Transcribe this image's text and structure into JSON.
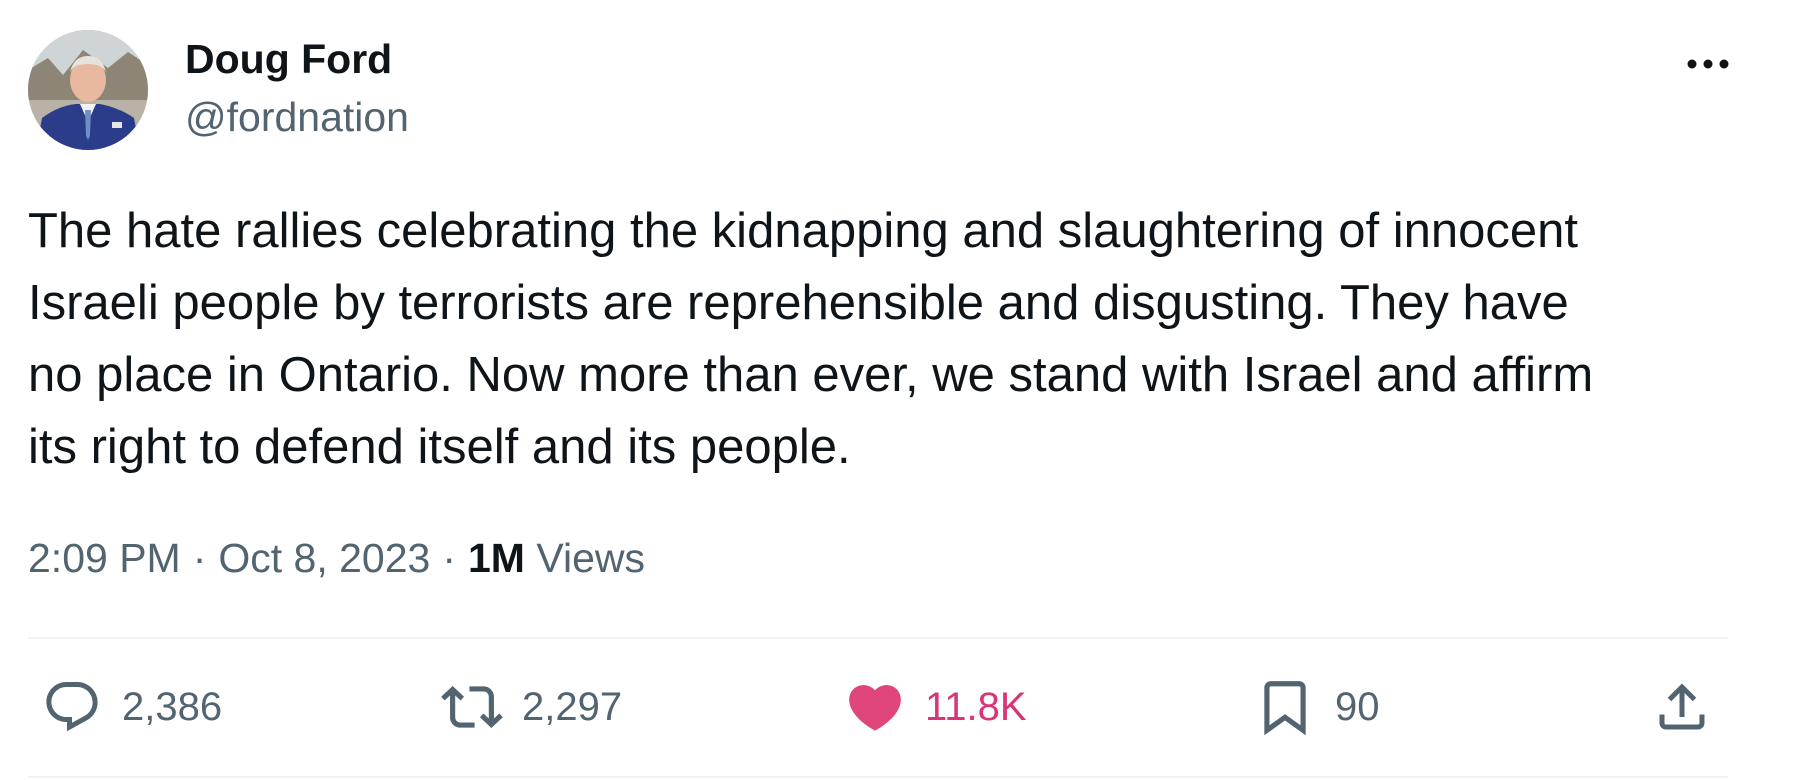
{
  "author": {
    "display_name": "Doug Ford",
    "handle": "@fordnation"
  },
  "tweet": {
    "text": "The hate rallies celebrating the kidnapping and slaughtering of innocent\nIsraeli people by terrorists are reprehensible and disgusting. They have\nno place in Ontario. Now more than ever, we stand with Israel and affirm\nits right to defend itself and its people.",
    "time": "2:09 PM",
    "date": "Oct 8, 2023",
    "separator": "·",
    "views_count": "1M",
    "views_label": "Views"
  },
  "actions": {
    "replies": "2,386",
    "reposts": "2,297",
    "likes": "11.8K",
    "bookmarks": "90"
  },
  "icons": {
    "more": "more-horizontal-icon",
    "reply": "reply-icon",
    "repost": "repost-icon",
    "like": "heart-filled-icon",
    "bookmark": "bookmark-icon",
    "share": "share-icon"
  },
  "colors": {
    "text_primary": "#0f1419",
    "text_secondary": "#536471",
    "like_active": "#f91880",
    "like_count": "#d93477",
    "divider": "#eff3f4"
  }
}
